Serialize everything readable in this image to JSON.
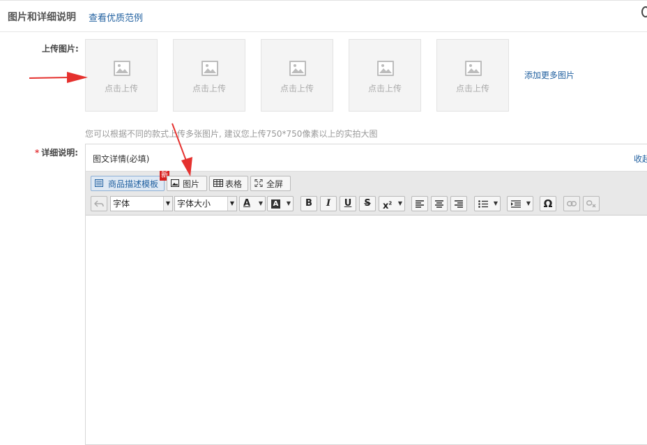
{
  "header": {
    "title": "图片和详细说明",
    "link": "查看优质范例"
  },
  "upload": {
    "label": "上传图片:",
    "boxes": [
      "点击上传",
      "点击上传",
      "点击上传",
      "点击上传",
      "点击上传"
    ],
    "add_more": "添加更多图片",
    "hint": "您可以根据不同的款式上传多张图片, 建议您上传750*750像素以上的实拍大图"
  },
  "detail": {
    "required_mark": "*",
    "label": "详细说明:",
    "editor_title": "图文详情(必填)",
    "collapse": "收起",
    "toolbar": {
      "template": "商品描述模板",
      "new_badge": "新",
      "image": "图片",
      "table": "表格",
      "fullscreen": "全屏",
      "font": "字体",
      "font_size": "字体大小"
    }
  },
  "colors": {
    "link": "#1f5f9f",
    "required": "#e4393c",
    "arrow": "#e5312e"
  }
}
